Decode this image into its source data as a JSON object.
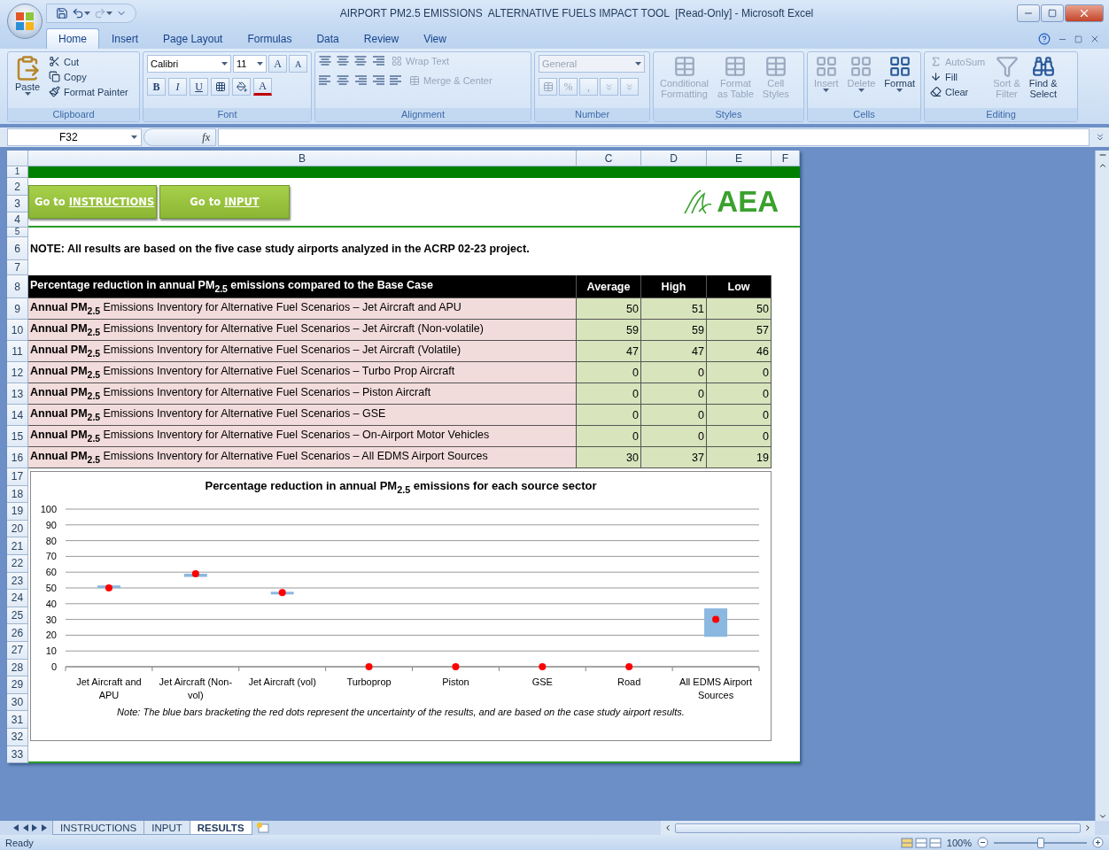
{
  "window": {
    "title": "AIRPORT PM2.5 EMISSIONS  ALTERNATIVE FUELS IMPACT TOOL  [Read-Only] - Microsoft Excel"
  },
  "ribbon_tabs": [
    {
      "label": "Home",
      "selected": true
    },
    {
      "label": "Insert",
      "selected": false
    },
    {
      "label": "Page Layout",
      "selected": false
    },
    {
      "label": "Formulas",
      "selected": false
    },
    {
      "label": "Data",
      "selected": false
    },
    {
      "label": "Review",
      "selected": false
    },
    {
      "label": "View",
      "selected": false
    }
  ],
  "ribbon": {
    "clipboard": {
      "title": "Clipboard",
      "paste": "Paste",
      "actions": [
        {
          "label": "Cut",
          "kind": "cut"
        },
        {
          "label": "Copy",
          "kind": "copy"
        },
        {
          "label": "Format Painter",
          "kind": "painter"
        }
      ]
    },
    "font": {
      "title": "Font",
      "name": "Calibri",
      "size": "11",
      "grow": "A",
      "shrink": "A",
      "styles": [
        "B",
        "I",
        "U"
      ],
      "color_button": "A"
    },
    "alignment": {
      "title": "Alignment",
      "wrap": {
        "label": "Wrap Text",
        "disabled": true
      },
      "merge": {
        "label": "Merge & Center",
        "disabled": true
      }
    },
    "number": {
      "title": "Number",
      "format": {
        "value": "General",
        "disabled": true
      },
      "buttons": [
        "%",
        ","
      ]
    },
    "styles": {
      "title": "Styles",
      "items": [
        {
          "lines": [
            "Conditional",
            "Formatting"
          ],
          "disabled": true
        },
        {
          "lines": [
            "Format",
            "as Table"
          ],
          "disabled": true
        },
        {
          "lines": [
            "Cell",
            "Styles"
          ],
          "disabled": true
        }
      ]
    },
    "cells": {
      "title": "Cells",
      "items": [
        {
          "label": "Insert",
          "disabled": true
        },
        {
          "label": "Delete",
          "disabled": true
        },
        {
          "label": "Format",
          "disabled": false
        }
      ]
    },
    "editing": {
      "title": "Editing",
      "small": [
        {
          "label": "AutoSum",
          "kind": "sum",
          "disabled": true
        },
        {
          "label": "Fill",
          "kind": "fill",
          "disabled": false
        },
        {
          "label": "Clear",
          "kind": "clear",
          "disabled": false
        }
      ],
      "big": [
        {
          "lines": [
            "Sort &",
            "Filter"
          ],
          "kind": "sort",
          "disabled": true
        },
        {
          "lines": [
            "Find &",
            "Select"
          ],
          "kind": "find",
          "disabled": false
        }
      ]
    }
  },
  "formula_bar": {
    "name_box": "F32",
    "function_label": "fx"
  },
  "sheet": {
    "columns": [
      "B",
      "C",
      "D",
      "E",
      "F"
    ],
    "row_numbers": [
      "1",
      "2",
      "3",
      "4",
      "5",
      "6",
      "7",
      "8",
      "9",
      "10",
      "11",
      "12",
      "13",
      "14",
      "15",
      "16",
      "17",
      "18",
      "19",
      "20",
      "21",
      "22",
      "23",
      "24",
      "25",
      "26",
      "27",
      "28",
      "29",
      "30",
      "31",
      "32",
      "33"
    ],
    "nav_buttons": [
      {
        "prefix": "Go to",
        "link": "INSTRUCTIONS"
      },
      {
        "prefix": "Go to",
        "link": "INPUT"
      }
    ],
    "logo": "AEA",
    "note": "NOTE: All results are based on the five case study airports analyzed in the ACRP 02-23 project.",
    "table": {
      "header": "Percentage reduction in annual PM$_{2.5}$ emissions compared to the Base Case",
      "columns": [
        "Average",
        "High",
        "Low"
      ],
      "rows": [
        {
          "label": "**Annual PM$_{2.5}$** Emissions Inventory for Alternative Fuel Scenarios – Jet Aircraft and APU",
          "values": [
            "50",
            "51",
            "50"
          ]
        },
        {
          "label": "**Annual PM$_{2.5}$** Emissions Inventory for Alternative Fuel Scenarios – Jet Aircraft (Non-volatile)",
          "values": [
            "59",
            "59",
            "57"
          ]
        },
        {
          "label": "**Annual PM$_{2.5}$** Emissions Inventory for Alternative Fuel Scenarios – Jet Aircraft (Volatile)",
          "values": [
            "47",
            "47",
            "46"
          ]
        },
        {
          "label": "**Annual PM$_{2.5}$** Emissions Inventory for Alternative Fuel Scenarios – Turbo Prop Aircraft",
          "values": [
            "0",
            "0",
            "0"
          ]
        },
        {
          "label": "**Annual PM$_{2.5}$** Emissions Inventory for Alternative Fuel Scenarios – Piston Aircraft",
          "values": [
            "0",
            "0",
            "0"
          ]
        },
        {
          "label": "**Annual PM$_{2.5}$** Emissions Inventory for Alternative Fuel Scenarios – GSE",
          "values": [
            "0",
            "0",
            "0"
          ]
        },
        {
          "label": "**Annual PM$_{2.5}$** Emissions Inventory for Alternative Fuel Scenarios – On-Airport Motor Vehicles",
          "values": [
            "0",
            "0",
            "0"
          ]
        },
        {
          "label": "**Annual PM$_{2.5}$** Emissions Inventory for Alternative Fuel Scenarios – All EDMS Airport Sources",
          "values": [
            "30",
            "37",
            "19"
          ]
        }
      ]
    },
    "chart": {
      "chart_data": {
        "type": "scatter",
        "title": "Percentage reduction in annual PM$_{2.5}$ emissions for each source sector",
        "categories": [
          "Jet Aircraft and APU",
          "Jet Aircraft (Non-vol)",
          "Jet Aircraft (vol)",
          "Turboprop",
          "Piston",
          "GSE",
          "Road",
          "All EDMS Airport Sources"
        ],
        "series": [
          {
            "color": "#ff0000",
            "values": [
              50,
              59,
              47,
              0,
              0,
              0,
              0,
              30
            ]
          }
        ],
        "grid": true,
        "ylim": [
          0,
          100
        ],
        "yticks": [
          0,
          10,
          20,
          30,
          40,
          50,
          60,
          70,
          80,
          90,
          100
        ]
      },
      "note": "Note: The blue bars bracketing the red dots represent the uncertainty of the results, and are based on the case study airport results."
    }
  },
  "sheet_tabs": [
    {
      "label": "INSTRUCTIONS",
      "selected": false
    },
    {
      "label": "INPUT",
      "selected": false
    },
    {
      "label": "RESULTS",
      "selected": true
    }
  ],
  "status_bar": {
    "status": "Ready",
    "zoom": "100%",
    "zoom_slider": {
      "level": 0.5
    }
  }
}
